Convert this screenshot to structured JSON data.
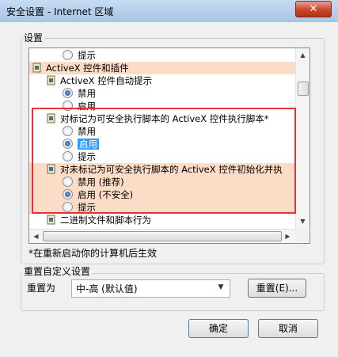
{
  "window": {
    "title": "安全设置 - Internet 区域",
    "close_glyph": "✕"
  },
  "settings_group": {
    "label": "设置"
  },
  "list": {
    "rows": [
      {
        "kind": "radio",
        "label": "提示",
        "checked": false
      },
      {
        "kind": "category",
        "label": "ActiveX 控件和插件"
      },
      {
        "kind": "setting",
        "label": "ActiveX 控件自动提示"
      },
      {
        "kind": "radio",
        "label": "禁用",
        "checked": true
      },
      {
        "kind": "radio",
        "label": "启用",
        "checked": false
      },
      {
        "kind": "setting",
        "label": "对标记为可安全执行脚本的 ActiveX 控件执行脚本*"
      },
      {
        "kind": "radio",
        "label": "禁用",
        "checked": false
      },
      {
        "kind": "radio",
        "label": "启用",
        "checked": true,
        "selected": true
      },
      {
        "kind": "radio",
        "label": "提示",
        "checked": false
      },
      {
        "kind": "setting",
        "label": "对未标记为可安全执行脚本的 ActiveX 控件初始化并执"
      },
      {
        "kind": "radio",
        "label": "禁用 (推荐)",
        "checked": false
      },
      {
        "kind": "radio",
        "label": "启用 (不安全)",
        "checked": true
      },
      {
        "kind": "radio",
        "label": "提示",
        "checked": false
      },
      {
        "kind": "setting",
        "label": "二进制文件和脚本行为"
      }
    ]
  },
  "footnote": "*在重新启动你的计算机后生效",
  "reset_group": {
    "label": "重置自定义设置",
    "reset_to_label": "重置为",
    "level_value": "中-高 (默认值)",
    "reset_button": "重置(E)..."
  },
  "buttons": {
    "ok": "确定",
    "cancel": "取消"
  },
  "colors": {
    "highlight": "#fbdcc7",
    "selection": "#3399ff",
    "annotation": "#e2333b"
  }
}
